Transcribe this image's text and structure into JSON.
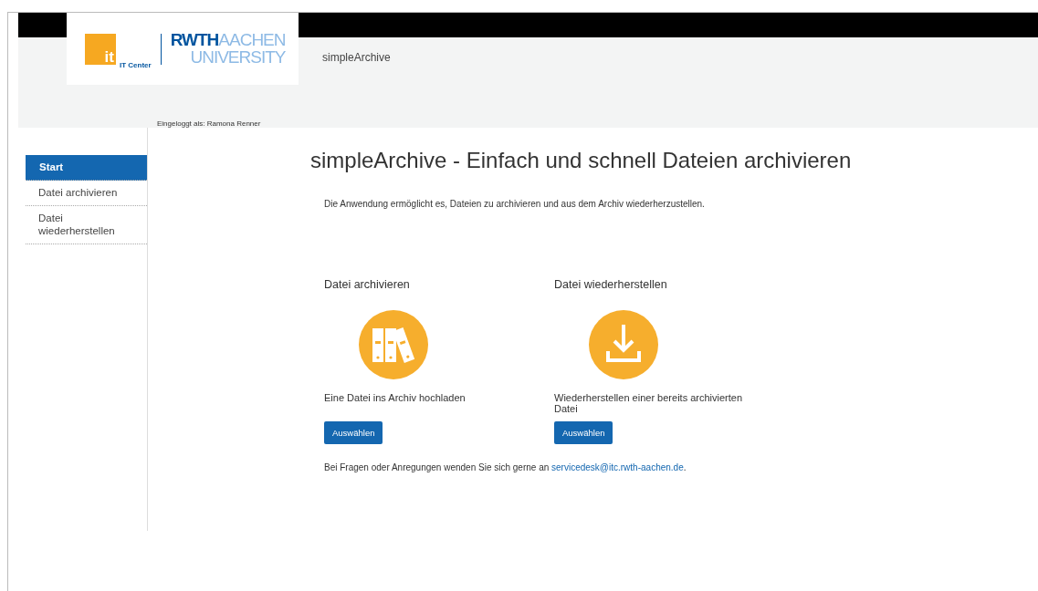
{
  "logo": {
    "mark": "it",
    "unit": "IT Center",
    "name_bold": "RWTH",
    "name_light": "AACHEN",
    "name_sub": "UNIVERSITY"
  },
  "app_title": "simpleArchive",
  "login_info": "Eingeloggt als: Ramona Renner",
  "sidebar": {
    "items": [
      {
        "label": "Start",
        "selected": true
      },
      {
        "label": "Datei archivieren",
        "selected": false
      },
      {
        "label": "Datei wiederherstellen",
        "selected": false
      }
    ]
  },
  "heading": "simpleArchive - Einfach und schnell Dateien archivieren",
  "intro": "Die Anwendung ermöglicht es, Dateien zu archivieren und aus dem Archiv wiederherzustellen.",
  "cards": [
    {
      "kind": "archive",
      "title": "Datei archivieren",
      "description": "Eine Datei ins Archiv hochladen",
      "button": "Auswählen"
    },
    {
      "kind": "restore",
      "title": "Datei wiederherstellen",
      "description": "Wiederherstellen einer bereits archivierten Datei",
      "button": "Auswählen"
    }
  ],
  "contact": {
    "text": "Bei Fragen oder Anregungen wenden Sie sich gerne an ",
    "link": "servicedesk@itc.rwth-aachen.de",
    "after": "."
  }
}
